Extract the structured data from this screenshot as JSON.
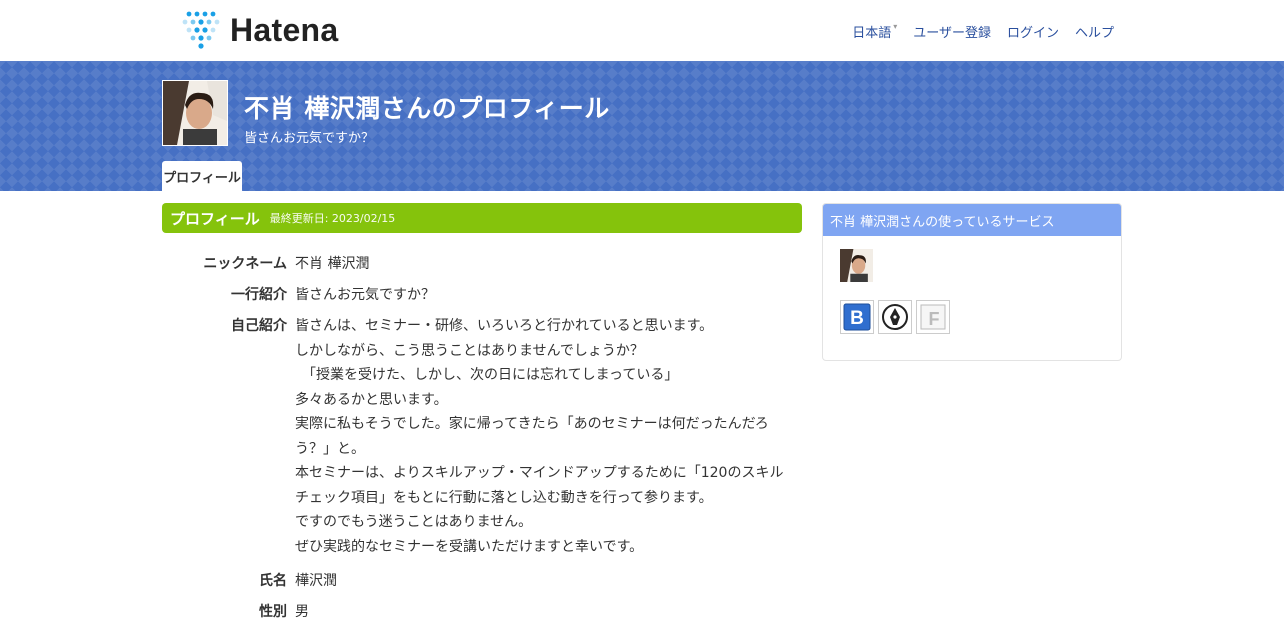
{
  "header": {
    "logo_text": "Hatena",
    "nav": {
      "language": "日本語",
      "register": "ユーザー登録",
      "login": "ログイン",
      "help": "ヘルプ"
    }
  },
  "banner": {
    "title": "不肖 樺沢潤さんのプロフィール",
    "subtitle": "皆さんお元気ですか？",
    "tab": "プロフィール"
  },
  "profile": {
    "section_title": "プロフィール",
    "updated": "最終更新日: 2023/02/15",
    "nickname_label": "ニックネーム",
    "nickname": "不肖 樺沢潤",
    "oneline_label": "一行紹介",
    "oneline": "皆さんお元気ですか？",
    "intro_label": "自己紹介",
    "intro_lines": [
      "皆さんは、セミナー・研修、いろいろと行かれていると思います。",
      "しかしながら、こう思うことはありませんでしょうか？",
      "　「授業を受けた、しかし、次の日には忘れてしまっている」",
      "多々あるかと思います。",
      "実際に私もそうでした。家に帰ってきたら「あのセミナーは何だったんだろ",
      "う？」と。",
      "本セミナーは、よりスキルアップ・マインドアップするために「120のスキル",
      "チェック項目」をもとに行動に落とし込む動きを行って参ります。",
      "ですのでもう迷うことはありません。",
      "ぜひ実践的なセミナーを受講いただけますと幸いです。"
    ],
    "name_label": "氏名",
    "name": "樺沢潤",
    "gender_label": "性別",
    "gender": "男"
  },
  "sidebar": {
    "title": "不肖 樺沢潤さんの使っているサービス",
    "services": [
      {
        "name": "hatena-bookmark",
        "glyph": "B"
      },
      {
        "name": "hatena-blog",
        "glyph": ""
      },
      {
        "name": "hatena-f",
        "glyph": "F"
      }
    ]
  },
  "colors": {
    "banner": "#4670c4",
    "section_head": "#85c30c",
    "side_head": "#7fa5f2",
    "nav_link": "#2a4f9e",
    "logo_dot": "#1aa0e6"
  }
}
